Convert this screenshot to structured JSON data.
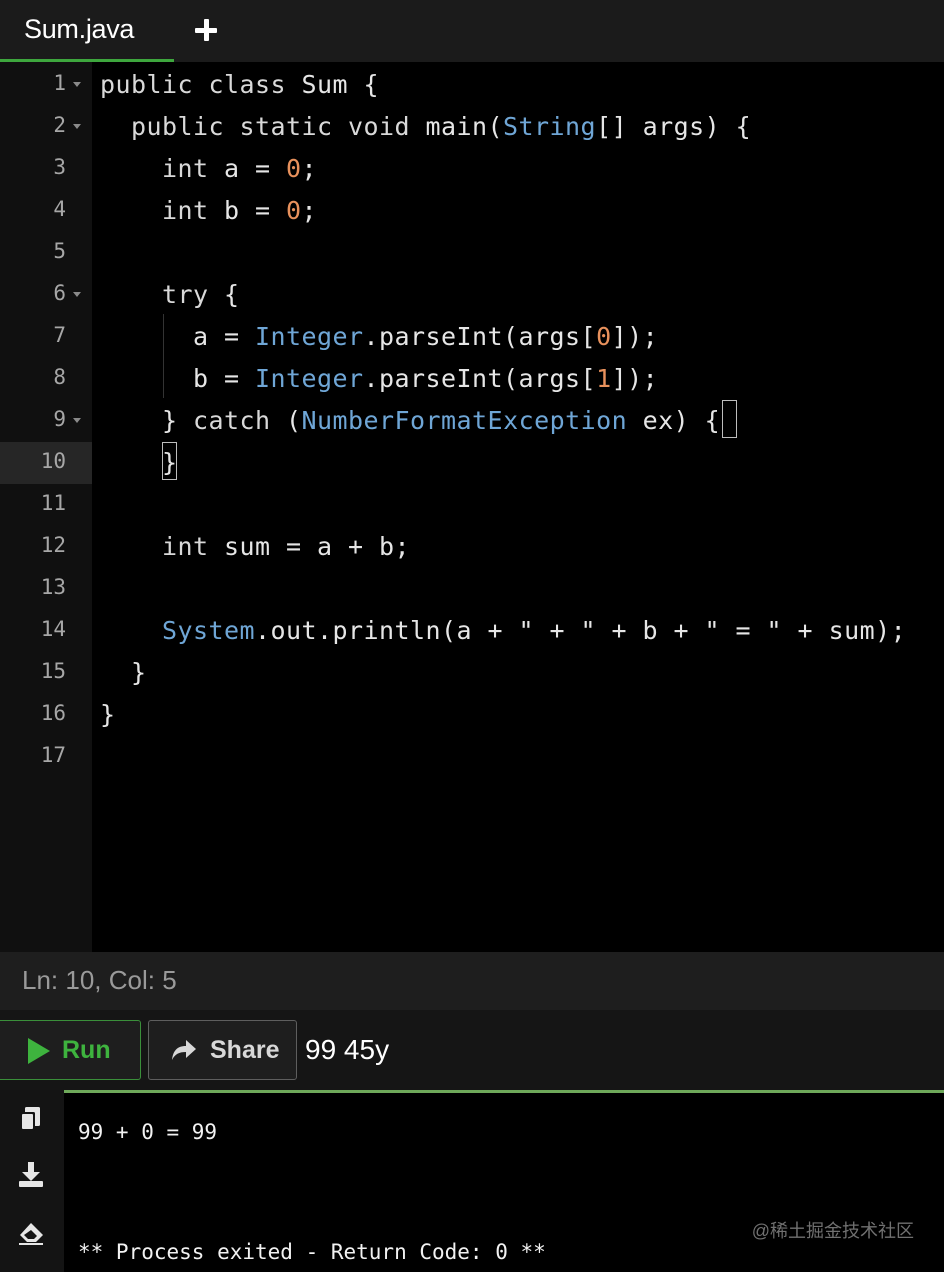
{
  "tabs": [
    {
      "label": "Sum.java",
      "active": true
    }
  ],
  "add_tab_icon": "plus-icon",
  "editor": {
    "active_line": 10,
    "line_numbers": [
      "1",
      "2",
      "3",
      "4",
      "5",
      "6",
      "7",
      "8",
      "9",
      "10",
      "11",
      "12",
      "13",
      "14",
      "15",
      "16",
      "17"
    ],
    "lines": [
      [
        [
          "kw",
          "public class "
        ],
        [
          "pl",
          "Sum {"
        ]
      ],
      [
        [
          "kw",
          "  public static void "
        ],
        [
          "pl",
          "main("
        ],
        [
          "ty",
          "String"
        ],
        [
          "pl",
          "[] args) {"
        ]
      ],
      [
        [
          "kw",
          "    int "
        ],
        [
          "pl",
          "a = "
        ],
        [
          "num",
          "0"
        ],
        [
          "pl",
          ";"
        ]
      ],
      [
        [
          "kw",
          "    int "
        ],
        [
          "pl",
          "b = "
        ],
        [
          "num",
          "0"
        ],
        [
          "pl",
          ";"
        ]
      ],
      [],
      [
        [
          "kw",
          "    try "
        ],
        [
          "pl",
          "{"
        ]
      ],
      [
        [
          "pl",
          "      a = "
        ],
        [
          "ty",
          "Integer"
        ],
        [
          "pl",
          ".parseInt(args["
        ],
        [
          "num",
          "0"
        ],
        [
          "pl",
          "]);"
        ]
      ],
      [
        [
          "pl",
          "      b = "
        ],
        [
          "ty",
          "Integer"
        ],
        [
          "pl",
          ".parseInt(args["
        ],
        [
          "num",
          "1"
        ],
        [
          "pl",
          "]);"
        ]
      ],
      [
        [
          "pl",
          "    } "
        ],
        [
          "kw",
          "catch "
        ],
        [
          "pl",
          "("
        ],
        [
          "ty",
          "NumberFormatException"
        ],
        [
          "pl",
          " ex) {"
        ]
      ],
      [
        [
          "pl",
          "    }"
        ]
      ],
      [],
      [
        [
          "kw",
          "    int "
        ],
        [
          "pl",
          "sum = a + b;"
        ]
      ],
      [],
      [
        [
          "ty",
          "    System"
        ],
        [
          "pl",
          ".out.println(a + \" + \" + b + \" = \" + sum);"
        ]
      ],
      [
        [
          "pl",
          "  }"
        ]
      ],
      [
        [
          "pl",
          "}"
        ]
      ],
      []
    ]
  },
  "status": {
    "cursor": "Ln: 10,  Col: 5"
  },
  "toolbar": {
    "run_label": "Run",
    "share_label": "Share",
    "args_value": "99 45y"
  },
  "output": {
    "lines": [
      "99 + 0 = 99",
      "** Process exited - Return Code: 0 **"
    ],
    "side_icons": [
      "copy-icon",
      "download-icon",
      "erase-icon"
    ]
  },
  "watermark": "@稀土掘金技术社区",
  "colors": {
    "accent_green": "#3eb33e",
    "type_blue": "#6fa6d6",
    "number_orange": "#e8915c"
  }
}
